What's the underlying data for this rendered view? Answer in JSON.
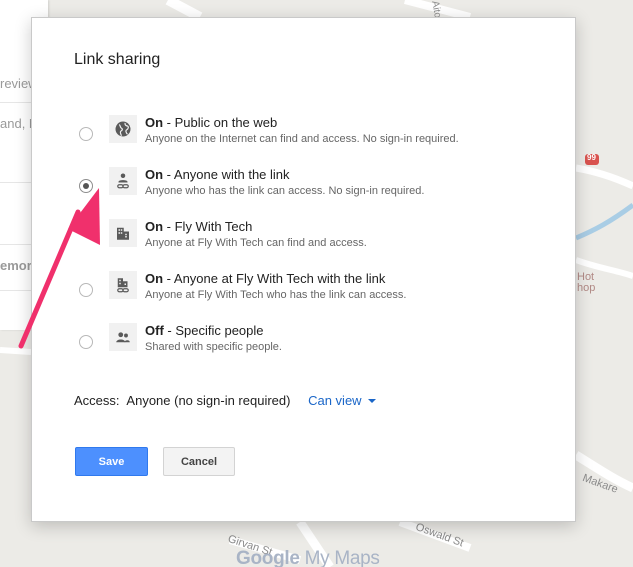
{
  "map": {
    "side_panel_rows": [
      "review",
      "and, N",
      "",
      "emoria"
    ],
    "labels": {
      "street_top": "Aitov",
      "highway_shield": "99",
      "hot_shop": "Hot\nhop",
      "makarewa": "Makare",
      "oswald": "Oswald St",
      "girvan": "Girvan St"
    },
    "brand": {
      "google": "Google",
      "product": " My Maps"
    },
    "colors": {
      "road": "#ffffff",
      "river": "#a9cde5",
      "land": "#ecebe7"
    }
  },
  "dialog": {
    "title": "Link sharing",
    "options": [
      {
        "state": "On",
        "title": " - Public on the web",
        "desc": "Anyone on the Internet can find and access. No sign-in required.",
        "icon": "globe-icon",
        "has_radio": true,
        "checked": false
      },
      {
        "state": "On",
        "title": " - Anyone with the link",
        "desc": "Anyone who has the link can access. No sign-in required.",
        "icon": "person-link-icon",
        "has_radio": true,
        "checked": true
      },
      {
        "state": "On",
        "title": " - Fly With Tech",
        "desc": "Anyone at Fly With Tech can find and access.",
        "icon": "building-icon",
        "has_radio": false,
        "checked": false
      },
      {
        "state": "On",
        "title": " - Anyone at Fly With Tech with the link",
        "desc": "Anyone at Fly With Tech who has the link can access.",
        "icon": "building-link-icon",
        "has_radio": true,
        "checked": false
      },
      {
        "state": "Off",
        "title": " - Specific people",
        "desc": "Shared with specific people.",
        "icon": "people-icon",
        "has_radio": true,
        "checked": false
      }
    ],
    "access": {
      "label": "Access:",
      "value": "Anyone (no sign-in required)",
      "permission": "Can view"
    },
    "buttons": {
      "save": "Save",
      "cancel": "Cancel"
    },
    "colors": {
      "primary": "#4d90fe",
      "link": "#1a66c8",
      "annotation_arrow": "#f0306c"
    }
  }
}
